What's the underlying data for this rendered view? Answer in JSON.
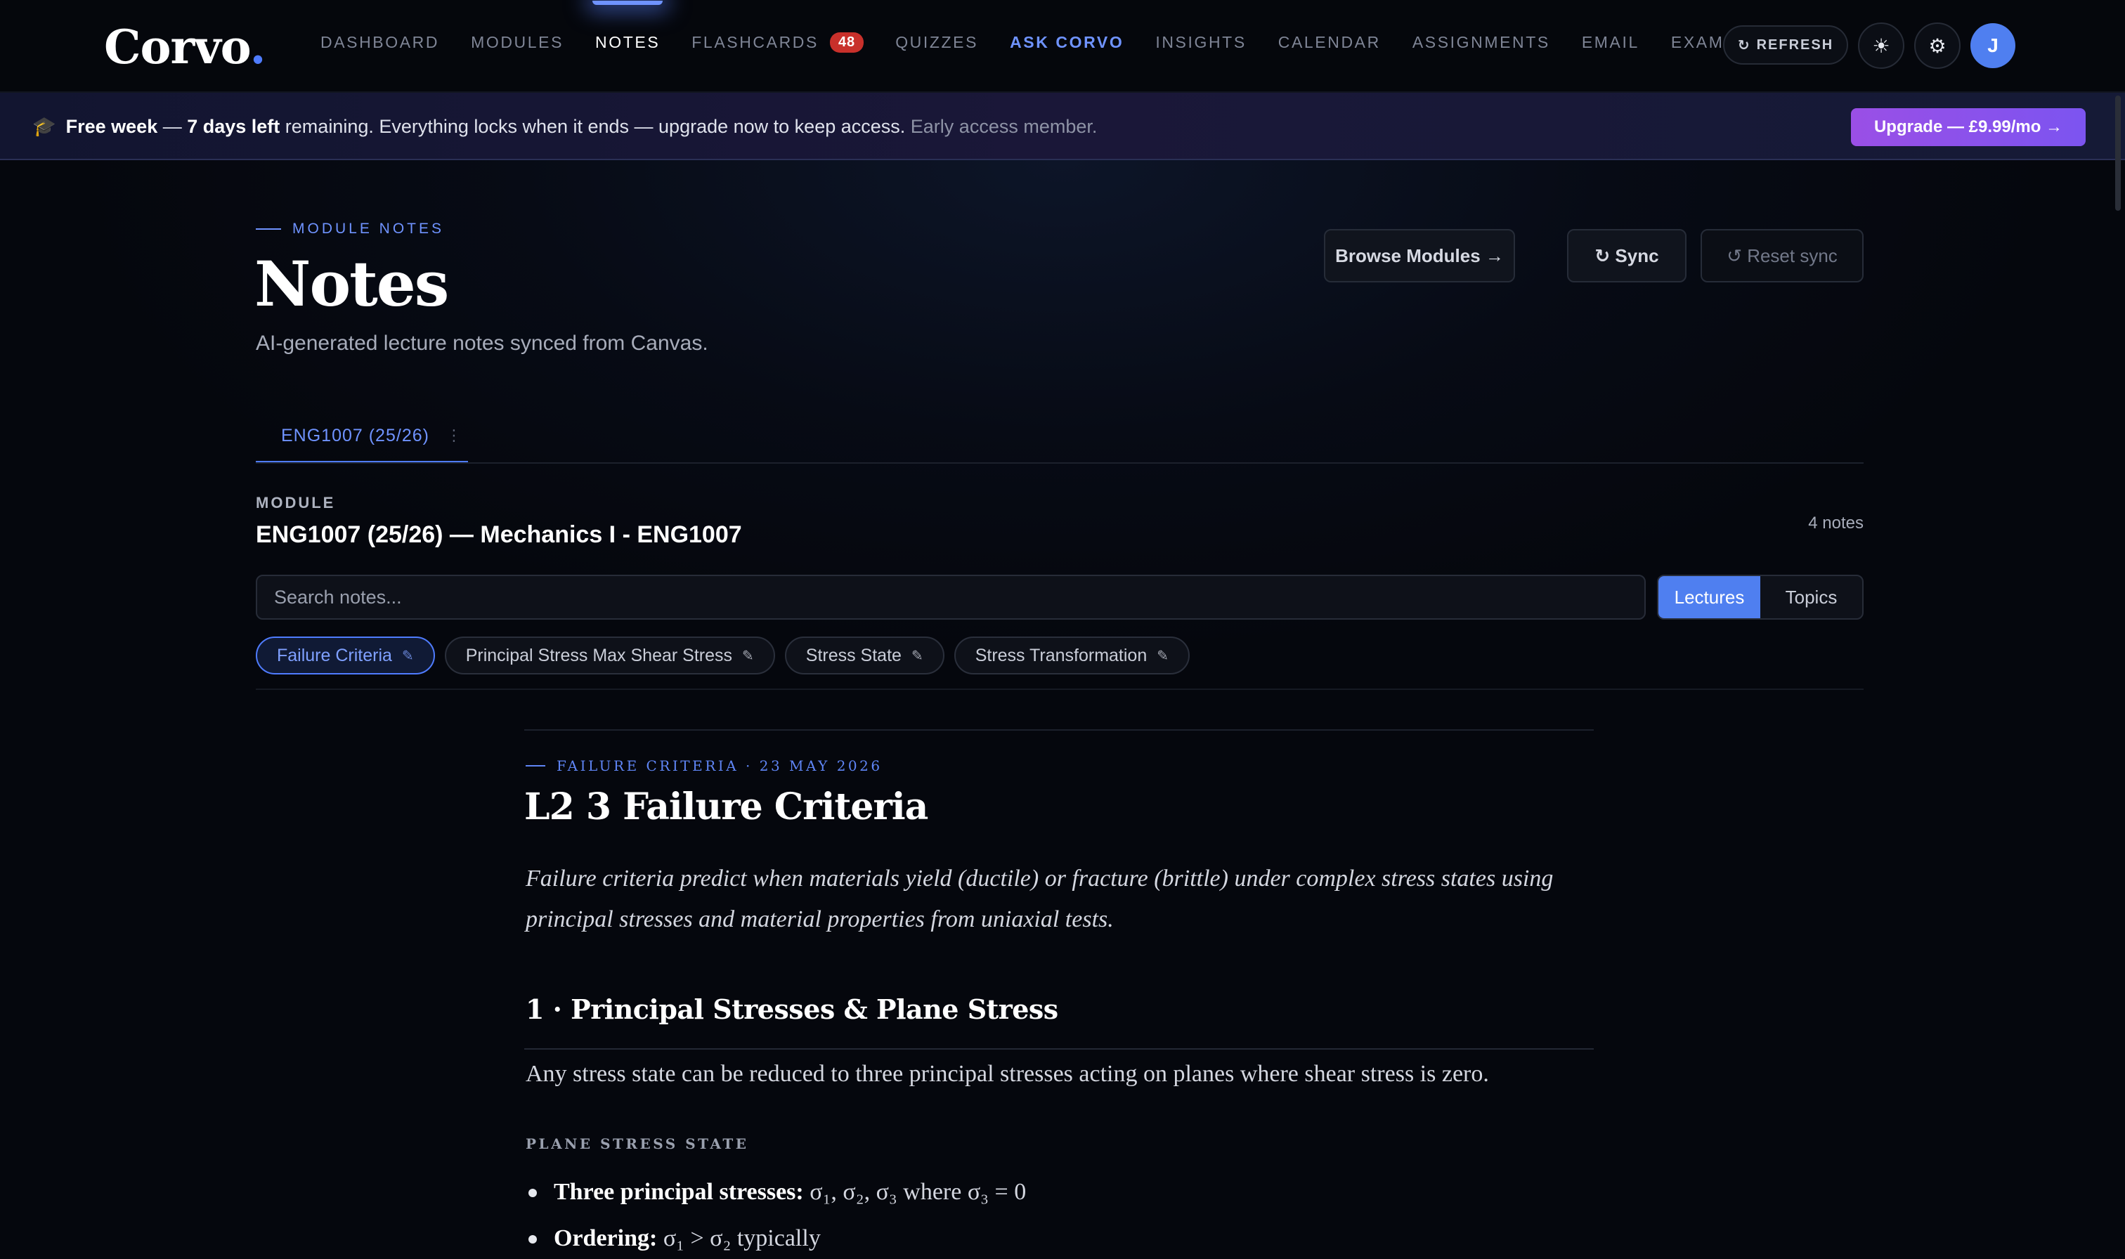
{
  "app": {
    "logo_text": "Corvo",
    "logo_dot": "."
  },
  "nav": {
    "items": [
      {
        "label": "DASHBOARD"
      },
      {
        "label": "MODULES"
      },
      {
        "label": "NOTES"
      },
      {
        "label": "FLASHCARDS",
        "badge": "48"
      },
      {
        "label": "QUIZZES"
      },
      {
        "label": "ASK CORVO"
      },
      {
        "label": "INSIGHTS"
      },
      {
        "label": "CALENDAR"
      },
      {
        "label": "ASSIGNMENTS"
      },
      {
        "label": "EMAIL"
      },
      {
        "label": "EXAMS"
      }
    ],
    "refresh_icon": "↻",
    "refresh_label": "REFRESH",
    "theme_icon": "☀",
    "settings_icon": "⚙",
    "avatar_initial": "J"
  },
  "banner": {
    "icon": "🎓",
    "bold1": "Free week",
    "dash": " — ",
    "bold2": "7 days left",
    "text": " remaining. Everything locks when it ends — upgrade now to keep access. ",
    "muted": "Early access member.",
    "upgrade_label": "Upgrade — £9.99/mo →"
  },
  "header": {
    "eyebrow": "MODULE NOTES",
    "title": "Notes",
    "subtitle": "AI-generated lecture notes synced from Canvas.",
    "browse_label": "Browse Modules →",
    "sync_label": "↻ Sync",
    "reset_label": "↺ Reset sync"
  },
  "tabs": [
    {
      "label": "ENG1007 (25/26)",
      "menu": "⋮"
    }
  ],
  "module": {
    "label": "MODULE",
    "title": "ENG1007 (25/26) — Mechanics I - ENG1007",
    "count": "4 notes"
  },
  "search": {
    "placeholder": "Search notes..."
  },
  "view_toggle": {
    "lectures": "Lectures",
    "topics": "Topics"
  },
  "chips": [
    {
      "label": "Failure Criteria",
      "icon": "✎"
    },
    {
      "label": "Principal Stress Max Shear Stress",
      "icon": "✎"
    },
    {
      "label": "Stress State",
      "icon": "✎"
    },
    {
      "label": "Stress Transformation",
      "icon": "✎"
    }
  ],
  "article": {
    "eyebrow": "FAILURE CRITERIA · 23 MAY 2026",
    "title": "L2 3 Failure Criteria",
    "lead": "Failure criteria predict when materials yield (ductile) or fracture (brittle) under complex stress states using principal stresses and material properties from uniaxial tests.",
    "section1_title": "1 · Principal Stresses & Plane Stress",
    "section1_body": "Any stress state can be reduced to three principal stresses acting on planes where shear stress is zero.",
    "sub_label": "PLANE STRESS STATE",
    "bullets": [
      {
        "term": "Three principal stresses:",
        "text": " σ₁, σ₂, σ₃ where σ₃ = 0"
      },
      {
        "term": "Ordering:",
        "text": " σ₁ > σ₂ typically"
      }
    ]
  }
}
